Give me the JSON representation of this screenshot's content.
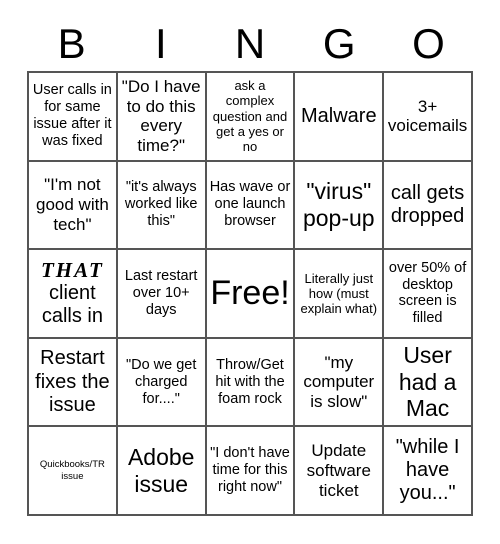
{
  "card": {
    "title": "BINGO",
    "header_letters": [
      "B",
      "I",
      "N",
      "G",
      "O"
    ],
    "free_space_label": "Free!",
    "colors": {
      "background": "#ffffff",
      "text": "#000000",
      "grid_line": "#555555"
    },
    "grid": {
      "columns": 5,
      "rows": 5,
      "cells": [
        {
          "text": "User calls in for same issue after it was fixed",
          "size": "sm"
        },
        {
          "text": "\"Do I have to do this every time?\"",
          "size": "md"
        },
        {
          "text": "ask a complex question and get a yes or no",
          "size": "xs"
        },
        {
          "text": "Malware",
          "size": "lg"
        },
        {
          "text": "3+ voicemails",
          "size": "md"
        },
        {
          "text": "\"I'm not good with tech\"",
          "size": "md"
        },
        {
          "text": "\"it's always worked like this\"",
          "size": "sm"
        },
        {
          "text": "Has wave or one launch browser",
          "size": "sm"
        },
        {
          "text": "\"virus\" pop-up",
          "size": "xl"
        },
        {
          "text": "call gets dropped",
          "size": "lg"
        },
        {
          "text": "THAT client calls in",
          "size": "lg",
          "style": "that"
        },
        {
          "text": "Last restart over 10+ days",
          "size": "sm"
        },
        {
          "text": "Free!",
          "size": "free",
          "free_space": true
        },
        {
          "text": "Literally just how (must explain what)",
          "size": "xs"
        },
        {
          "text": "over 50% of desktop screen is filled",
          "size": "sm"
        },
        {
          "text": "Restart fixes the issue",
          "size": "lg"
        },
        {
          "text": "\"Do we get charged for....\"",
          "size": "sm"
        },
        {
          "text": "Throw/Get hit with the foam rock",
          "size": "sm"
        },
        {
          "text": "\"my computer is slow\"",
          "size": "md"
        },
        {
          "text": "User had a Mac",
          "size": "xl"
        },
        {
          "text": "Quickbooks/TR issue",
          "size": "tiny"
        },
        {
          "text": "Adobe issue",
          "size": "xl"
        },
        {
          "text": "\"I don't have time for this right now\"",
          "size": "sm"
        },
        {
          "text": "Update software ticket",
          "size": "md"
        },
        {
          "text": "\"while I have you...\"",
          "size": "lg"
        }
      ]
    }
  }
}
